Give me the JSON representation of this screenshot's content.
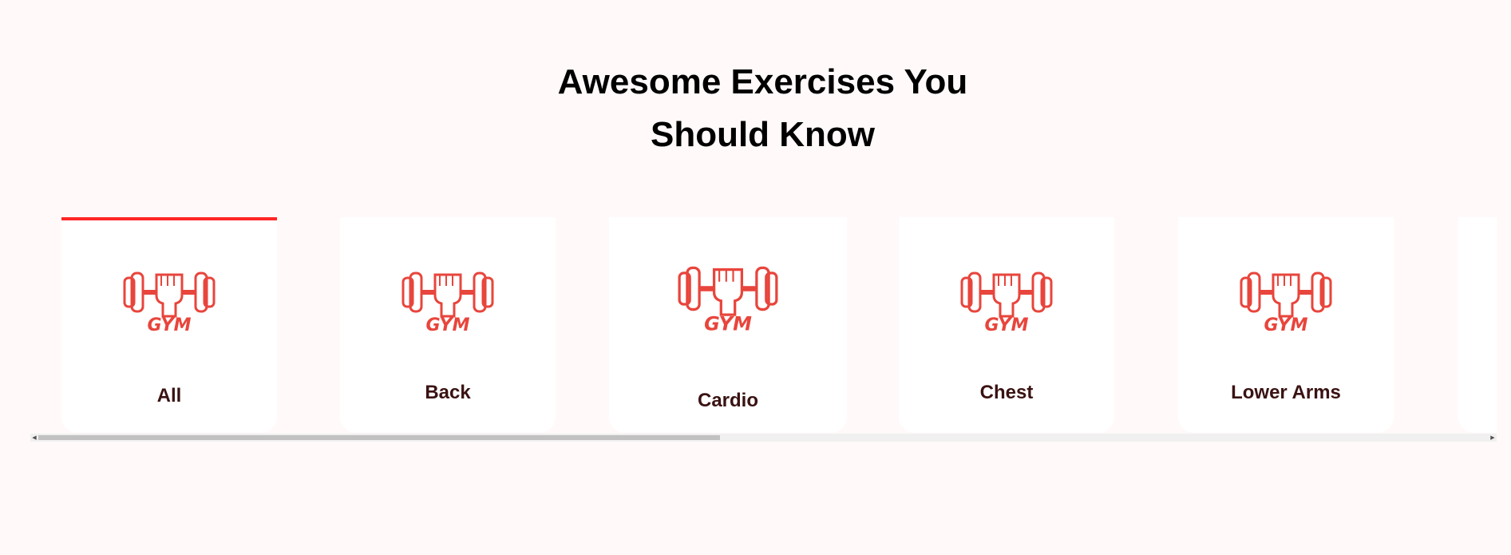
{
  "heading": {
    "line1": "Awesome Exercises You",
    "line2": "Should Know"
  },
  "accent_color": "#ff2625",
  "logo_color": "#e8453c",
  "body_parts": [
    {
      "label": "All",
      "selected": true,
      "icon": "gym-dumbbell-fist-icon",
      "logo_text": "GYM"
    },
    {
      "label": "Back",
      "selected": false,
      "icon": "gym-dumbbell-fist-icon",
      "logo_text": "GYM"
    },
    {
      "label": "Cardio",
      "selected": false,
      "icon": "gym-dumbbell-fist-icon",
      "logo_text": "GYM"
    },
    {
      "label": "Chest",
      "selected": false,
      "icon": "gym-dumbbell-fist-icon",
      "logo_text": "GYM"
    },
    {
      "label": "Lower Arms",
      "selected": false,
      "icon": "gym-dumbbell-fist-icon",
      "logo_text": "GYM"
    }
  ],
  "scrollbar": {
    "thumb_fraction": 0.47,
    "position_fraction": 0.0
  }
}
